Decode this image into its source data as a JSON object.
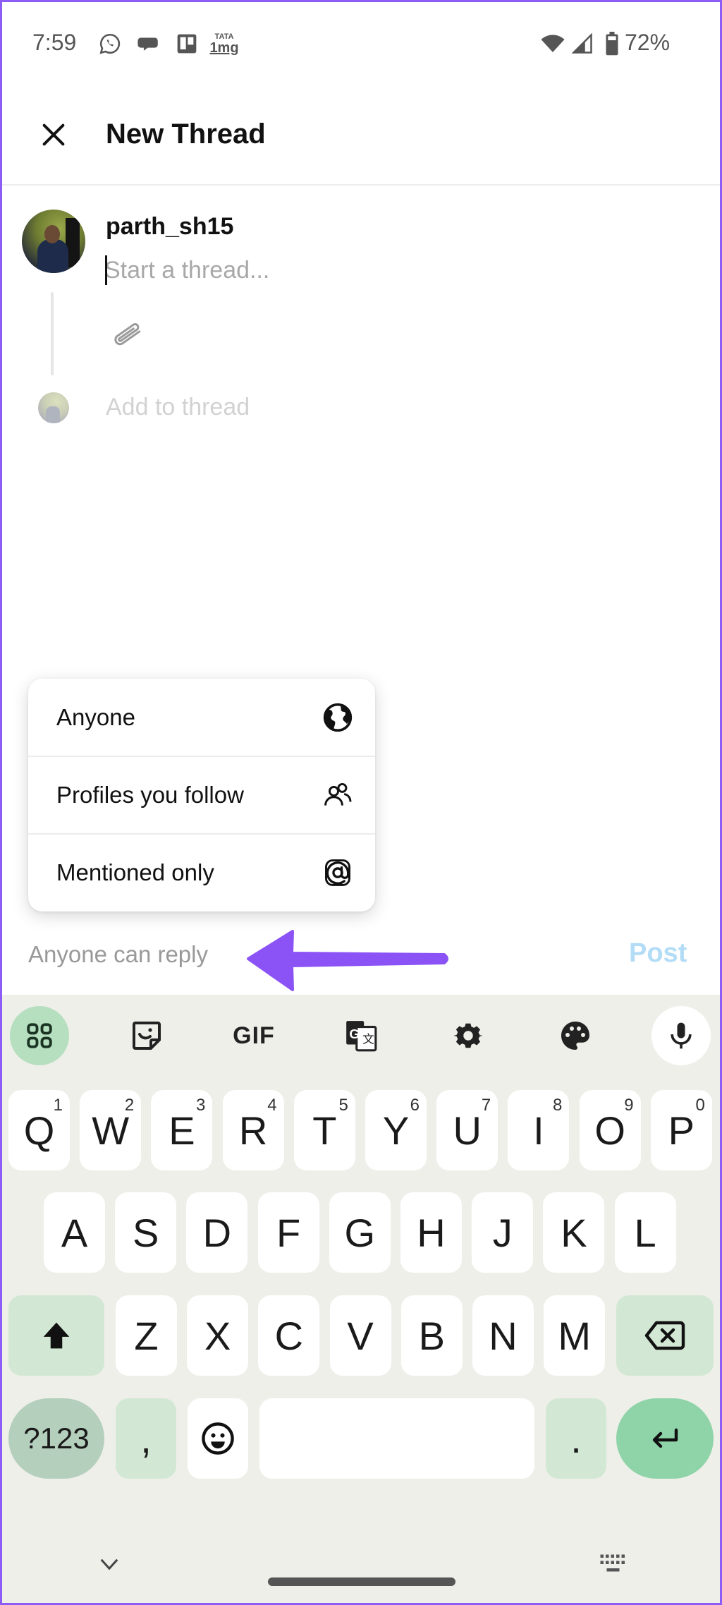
{
  "status_bar": {
    "time": "7:59",
    "notification_icons": [
      "whatsapp-icon",
      "messages-icon",
      "trello-icon",
      "tata-1mg-icon"
    ],
    "tata_label_top": "TATA",
    "tata_label_bottom": "1mg",
    "system_icons": [
      "wifi-icon",
      "signal-icon",
      "battery-icon"
    ],
    "battery": "72%"
  },
  "header": {
    "close_icon": "close-icon",
    "title": "New Thread"
  },
  "composer": {
    "username": "parth_sh15",
    "input_value": "",
    "input_placeholder": "Start a thread...",
    "attach_icon": "paperclip-icon",
    "add_to_thread": "Add to thread"
  },
  "reply_menu": {
    "items": [
      {
        "label": "Anyone",
        "icon": "globe-icon"
      },
      {
        "label": "Profiles you follow",
        "icon": "people-icon"
      },
      {
        "label": "Mentioned only",
        "icon": "at-sign-icon"
      }
    ]
  },
  "footer": {
    "reply_setting": "Anyone can reply",
    "post_label": "Post",
    "post_color": "#b3dcf7",
    "annotation_arrow_color": "#8b52f5"
  },
  "keyboard": {
    "toolbar": [
      "apps-grid-icon",
      "sticker-icon",
      "gif-icon",
      "translate-icon",
      "settings-gear-icon",
      "palette-icon",
      "microphone-icon"
    ],
    "gif_label": "GIF",
    "row1": [
      {
        "key": "Q",
        "hint": "1"
      },
      {
        "key": "W",
        "hint": "2"
      },
      {
        "key": "E",
        "hint": "3"
      },
      {
        "key": "R",
        "hint": "4"
      },
      {
        "key": "T",
        "hint": "5"
      },
      {
        "key": "Y",
        "hint": "6"
      },
      {
        "key": "U",
        "hint": "7"
      },
      {
        "key": "I",
        "hint": "8"
      },
      {
        "key": "O",
        "hint": "9"
      },
      {
        "key": "P",
        "hint": "0"
      }
    ],
    "row2": [
      "A",
      "S",
      "D",
      "F",
      "G",
      "H",
      "J",
      "K",
      "L"
    ],
    "row3": [
      "Z",
      "X",
      "C",
      "V",
      "B",
      "N",
      "M"
    ],
    "symbols_label": "?123",
    "comma_label": ",",
    "period_label": ".",
    "space_label": "",
    "accent_color": "#8fd4a8",
    "background_color": "#efefea"
  }
}
